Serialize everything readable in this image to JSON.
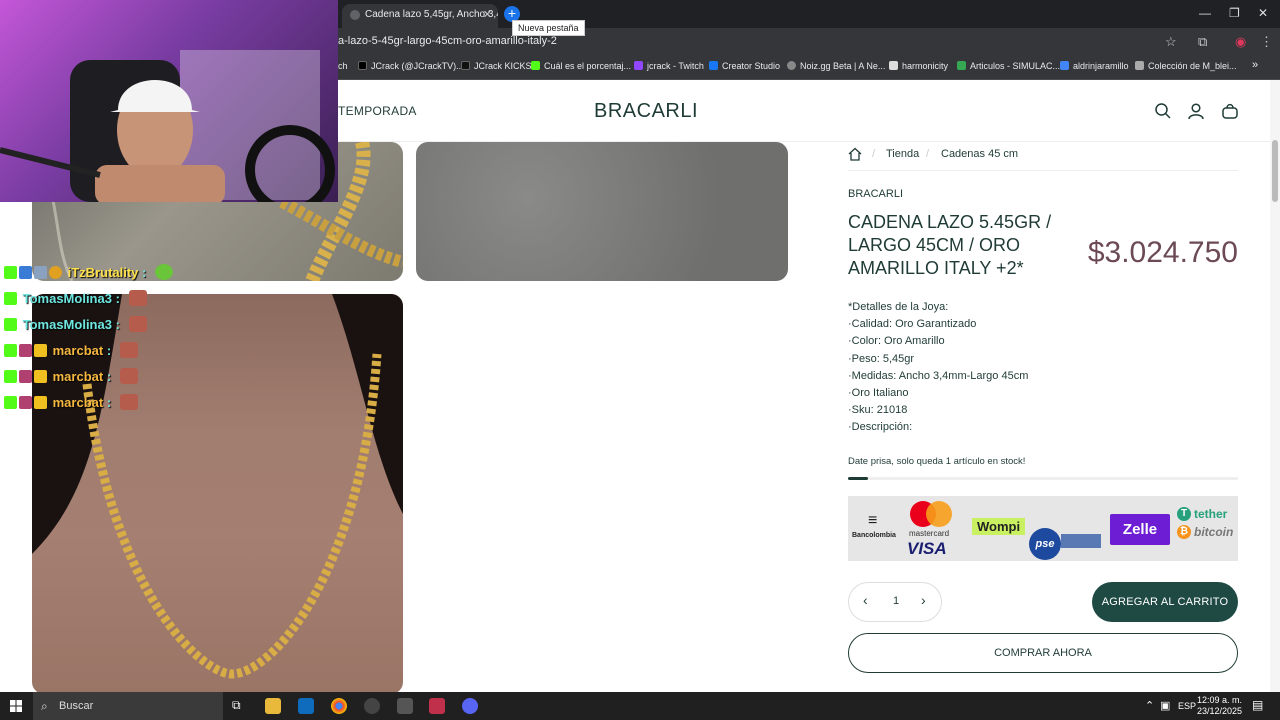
{
  "browser": {
    "tab_title": "Cadena lazo 5,45gr, Ancho 3,4",
    "new_tab_tooltip": "Nueva pestaña",
    "url": "a-lazo-5-45gr-largo-45cm-oro-amarillo-italy-2",
    "bookmarks": [
      {
        "label": "ch",
        "color": "#5f6368"
      },
      {
        "label": "JCrack (@JCrackTV)...",
        "color": "#000000"
      },
      {
        "label": "JCrack KICKS",
        "color": "#111111"
      },
      {
        "label": "Cuál es el porcentaj...",
        "color": "#53fc18"
      },
      {
        "label": "jcrack - Twitch",
        "color": "#9146ff"
      },
      {
        "label": "Creator Studio",
        "color": "#1877f2"
      },
      {
        "label": "Noiz.gg Beta | A Ne...",
        "color": "#888888"
      },
      {
        "label": "harmonicity",
        "color": "#dddddd"
      },
      {
        "label": "Articulos - SIMULAC...",
        "color": "#34a853"
      },
      {
        "label": "aldrinjaramillo",
        "color": "#4285f4"
      },
      {
        "label": "Colección de M_blei...",
        "color": "#aaaaaa"
      }
    ]
  },
  "header": {
    "nav_left": "TEMPORADA",
    "brand": "BRACARLI"
  },
  "chat": [
    {
      "user": "iTzBrutality",
      "color": "#ffe24a"
    },
    {
      "user": "TomasMolina3",
      "color": "#6ee7e0"
    },
    {
      "user": "TomasMolina3",
      "color": "#6ee7e0"
    },
    {
      "user": "marcbat",
      "color": "#f5b740"
    },
    {
      "user": "marcbat",
      "color": "#f5b740"
    },
    {
      "user": "marcbat",
      "color": "#f5b740"
    }
  ],
  "breadcrumb": {
    "shop": "Tienda",
    "category": "Cadenas 45 cm"
  },
  "product": {
    "vendor": "BRACARLI",
    "title": "CADENA LAZO 5.45GR / LARGO 45CM / ORO AMARILLO ITALY +2*",
    "price": "$3.024.750",
    "details": [
      "*Detalles de la Joya:",
      "·Calidad: Oro Garantizado",
      "·Color: Oro Amarillo",
      "·Peso: 5,45gr",
      "·Medidas: Ancho 3,4mm-Largo 45cm",
      "·Oro Italiano",
      "·Sku: 21018",
      "·Descripción:"
    ],
    "stock_text": "Date prisa, solo queda 1 artículo en stock!",
    "stock_level": 0.05,
    "quantity": "1",
    "add_to_cart": "AGREGAR AL CARRITO",
    "buy_now": "COMPRAR AHORA"
  },
  "payments": {
    "bancolombia": "Bancolombia",
    "mastercard": "mastercard",
    "visa": "VISA",
    "wompi": "Wompi",
    "pse": "pse",
    "zelle": "Zelle",
    "tether": "tether",
    "bitcoin": "bitcoin"
  },
  "taskbar": {
    "search": "Buscar",
    "lang": "ESP",
    "time": "12:09 a. m.",
    "date": "23/12/2025"
  }
}
